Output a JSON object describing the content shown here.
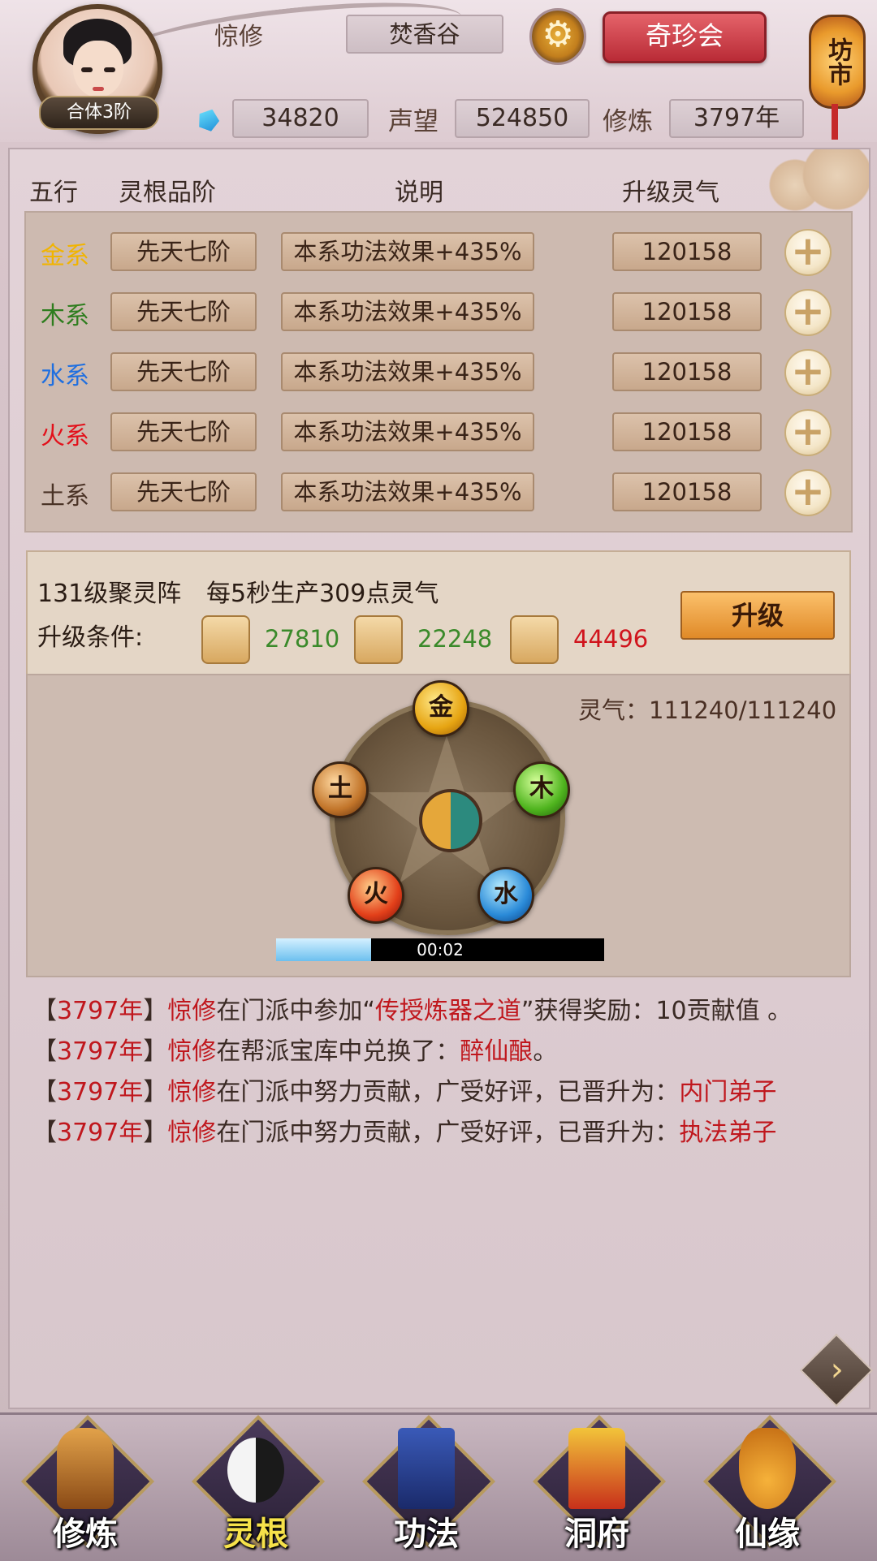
{
  "header": {
    "player_name": "惊修",
    "rank_badge": "合体3阶",
    "sect": "焚香谷",
    "settings_icon": "gear-icon",
    "treasure_button": "奇珍会",
    "market_sign": "坊市",
    "gems": "34820",
    "reputation_label": "声望",
    "reputation": "524850",
    "cultivation_label": "修炼",
    "cultivation_years": "3797年"
  },
  "table": {
    "headers": [
      "五行",
      "灵根品阶",
      "说明",
      "升级灵气"
    ],
    "rows": [
      {
        "element": "金系",
        "color": "#f1b400",
        "grade": "先天七阶",
        "desc": "本系功法效果+435%",
        "cost": "120158"
      },
      {
        "element": "木系",
        "color": "#2e7d1e",
        "grade": "先天七阶",
        "desc": "本系功法效果+435%",
        "cost": "120158"
      },
      {
        "element": "水系",
        "color": "#1f6fe0",
        "grade": "先天七阶",
        "desc": "本系功法效果+435%",
        "cost": "120158"
      },
      {
        "element": "火系",
        "color": "#e3101a",
        "grade": "先天七阶",
        "desc": "本系功法效果+435%",
        "cost": "120158"
      },
      {
        "element": "土系",
        "color": "#4a3326",
        "grade": "先天七阶",
        "desc": "本系功法效果+435%",
        "cost": "120158"
      }
    ]
  },
  "gather": {
    "title": "131级聚灵阵",
    "production": "每5秒生产309点灵气",
    "condition_label": "升级条件:",
    "resources": [
      {
        "icon": "ore-icon",
        "value": "27810",
        "color": "#3a8a2a"
      },
      {
        "icon": "wood-icon",
        "value": "22248",
        "color": "#3a8a2a"
      },
      {
        "icon": "herb-icon",
        "value": "44496",
        "color": "#d0141c"
      }
    ],
    "upgrade_button": "升级"
  },
  "wheel": {
    "lingqi": "灵气：111240/111240",
    "orbs": [
      "金",
      "木",
      "水",
      "火",
      "土"
    ],
    "timer": "00:02",
    "progress": 0.29
  },
  "log": [
    {
      "year": "3797年",
      "name": "惊修",
      "text1": "在门派中参加“",
      "hl": "传授炼器之道",
      "text2": "”获得奖励：10贡献值 。"
    },
    {
      "year": "3797年",
      "name": "惊修",
      "text1": "在帮派宝库中兑换了：",
      "hl": "醉仙酿",
      "text2": "。"
    },
    {
      "year": "3797年",
      "name": "惊修",
      "text1": "在门派中努力贡献，广受好评，已晋升为：",
      "hl": "内门弟子",
      "text2": ""
    },
    {
      "year": "3797年",
      "name": "惊修",
      "text1": "在门派中努力贡献，广受好评，已晋升为：",
      "hl": "执法弟子",
      "text2": ""
    }
  ],
  "nav": [
    {
      "label": "修炼",
      "icon": "cultivate-icon",
      "active": false
    },
    {
      "label": "灵根",
      "icon": "spirit-root-icon",
      "active": true
    },
    {
      "label": "功法",
      "icon": "manual-icon",
      "active": false
    },
    {
      "label": "洞府",
      "icon": "cave-icon",
      "active": false
    },
    {
      "label": "仙缘",
      "icon": "gourd-icon",
      "active": false
    }
  ]
}
